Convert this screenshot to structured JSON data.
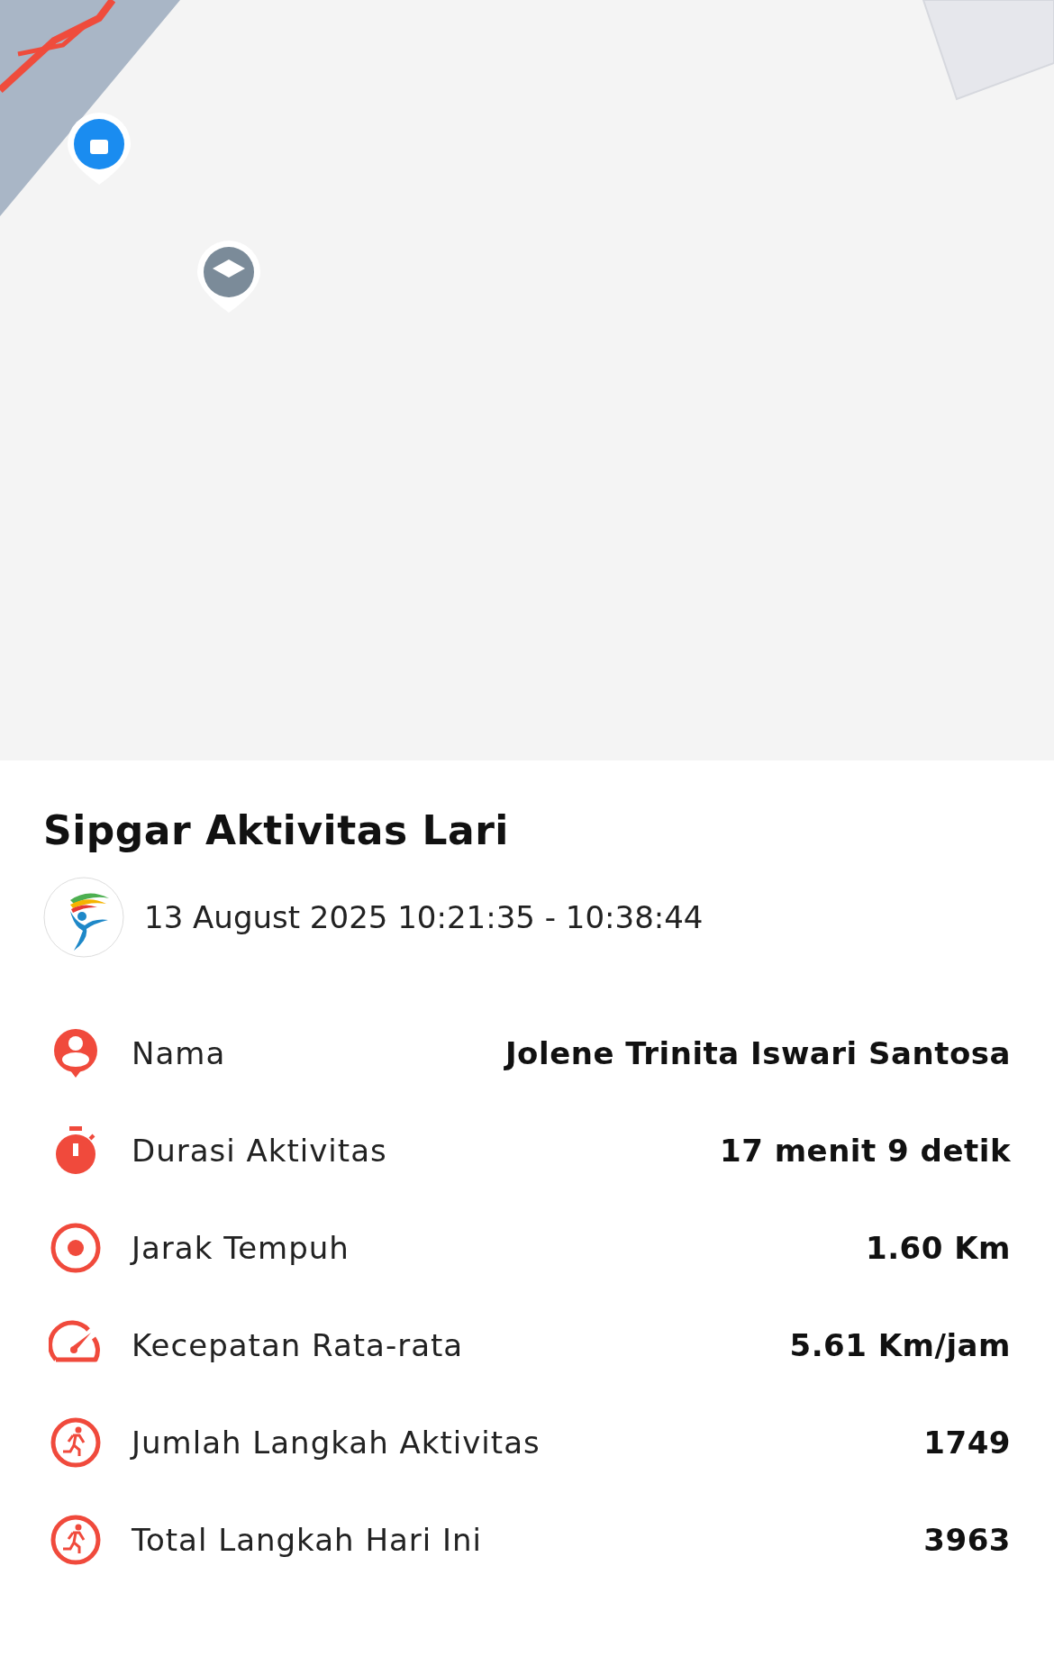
{
  "summary": {
    "title": "Sipgar Aktivitas Lari",
    "datetime": "13 August 2025 10:21:35 - 10:38:44"
  },
  "stats": [
    {
      "kind": "person",
      "label": "Nama",
      "value": "Jolene Trinita Iswari Santosa"
    },
    {
      "kind": "timer",
      "label": "Durasi Aktivitas",
      "value": "17 menit 9 detik"
    },
    {
      "kind": "target",
      "label": "Jarak Tempuh",
      "value": "1.60 Km"
    },
    {
      "kind": "speed",
      "label": "Kecepatan Rata-rata",
      "value": "5.61 Km/jam"
    },
    {
      "kind": "steps",
      "label": "Jumlah Langkah Aktivitas",
      "value": "1749"
    },
    {
      "kind": "steps",
      "label": "Total Langkah Hari Ini",
      "value": "3963"
    }
  ]
}
